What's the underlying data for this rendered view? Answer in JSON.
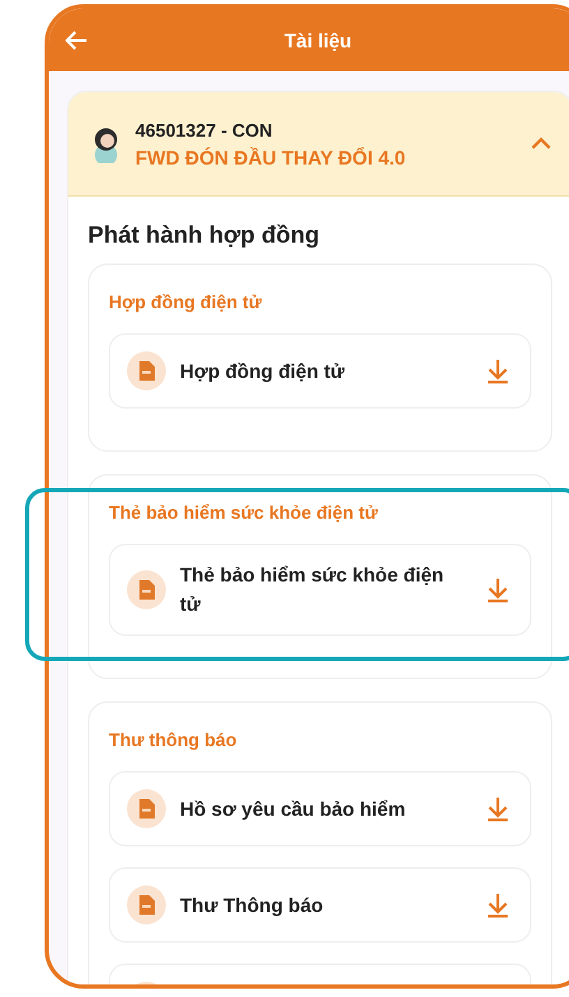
{
  "header": {
    "title": "Tài liệu"
  },
  "contract": {
    "id": "46501327 - CON",
    "name": "FWD ĐÓN ĐẦU THAY ĐỔI 4.0",
    "expanded": true
  },
  "heading": "Phát hành hợp đồng",
  "sections": [
    {
      "title": "Hợp đồng điện tử",
      "highlighted": false,
      "items": [
        {
          "kind": "file",
          "label": "Hợp đồng điện tử"
        }
      ]
    },
    {
      "title": "Thẻ bảo hiểm sức khỏe điện tử",
      "highlighted": true,
      "items": [
        {
          "kind": "file",
          "label": "Thẻ bảo hiểm sức khỏe điện tử"
        }
      ]
    },
    {
      "title": "Thư thông báo",
      "highlighted": false,
      "items": [
        {
          "kind": "file",
          "label": "Hồ sơ yêu cầu bảo hiểm"
        },
        {
          "kind": "file",
          "label": "Thư Thông báo"
        },
        {
          "kind": "partial"
        }
      ]
    }
  ]
}
